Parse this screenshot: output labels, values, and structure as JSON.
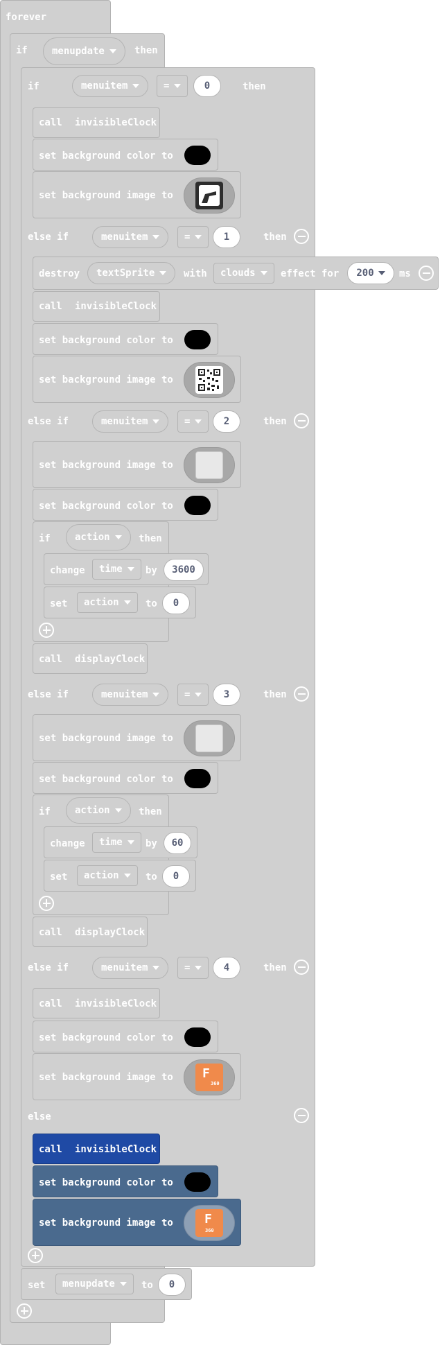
{
  "blocks": {
    "forever": "forever",
    "if": "if",
    "then": "then",
    "else_if": "else if",
    "else": "else",
    "menupdate": "menupdate",
    "menuitem": "menuitem",
    "eq": "=",
    "call": "call",
    "invisibleClock": "invisibleClock",
    "displayClock": "displayClock",
    "set_bg_color": "set background color to",
    "set_bg_image": "set background image to",
    "destroy": "destroy",
    "textSprite": "textSprite",
    "with": "with",
    "clouds": "clouds",
    "effect_for": "effect for",
    "ms": "ms",
    "action": "action",
    "change": "change",
    "time": "time",
    "by": "by",
    "set": "set",
    "to": "to"
  },
  "values": {
    "v0": "0",
    "v1": "1",
    "v2": "2",
    "v3": "3",
    "v4": "4",
    "dur": "200",
    "hour": "3600",
    "min": "60",
    "zero": "0",
    "image_letter": "F",
    "image_caption": "360"
  },
  "colors": {
    "block_gray": "#d0d0d0",
    "selected_dark": "#1f4aa5",
    "selected_light": "#4a6a8e",
    "black_swatch": "#000000",
    "image_orange": "#f08a4b"
  },
  "icons": [
    "picture-icon",
    "qr-code-icon",
    "blank-image-icon",
    "f360-logo-icon",
    "minus-circle-icon",
    "plus-circle-icon",
    "dropdown-arrow-icon"
  ]
}
